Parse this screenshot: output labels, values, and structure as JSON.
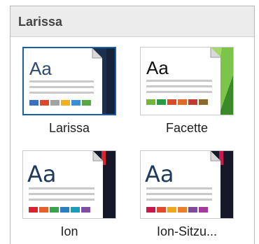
{
  "panel": {
    "title": "Larissa"
  },
  "themes": [
    {
      "name": "Larissa",
      "sample": "Aa",
      "selected": true,
      "swatches": [
        "#3c6fc2",
        "#e0462b",
        "#a2a2a2",
        "#f2b01a",
        "#3a8fd9",
        "#58a842"
      ]
    },
    {
      "name": "Facette",
      "sample": "Aa",
      "selected": false,
      "swatches": [
        "#74b53b",
        "#2c9a42",
        "#d64c28",
        "#e06a28",
        "#c23a32",
        "#8a6a2a"
      ]
    },
    {
      "name": "Ion",
      "sample": "Aa",
      "selected": false,
      "swatches": [
        "#d8242e",
        "#e3612b",
        "#3aa24a",
        "#2b7fbf",
        "#1b9db8",
        "#7f4ea3"
      ]
    },
    {
      "name": "Ion-Sitzu...",
      "sample": "Aa",
      "selected": false,
      "swatches": [
        "#c8194f",
        "#e14a2b",
        "#efa81c",
        "#e87f2a",
        "#7d4a9e",
        "#a43b9c"
      ]
    }
  ]
}
